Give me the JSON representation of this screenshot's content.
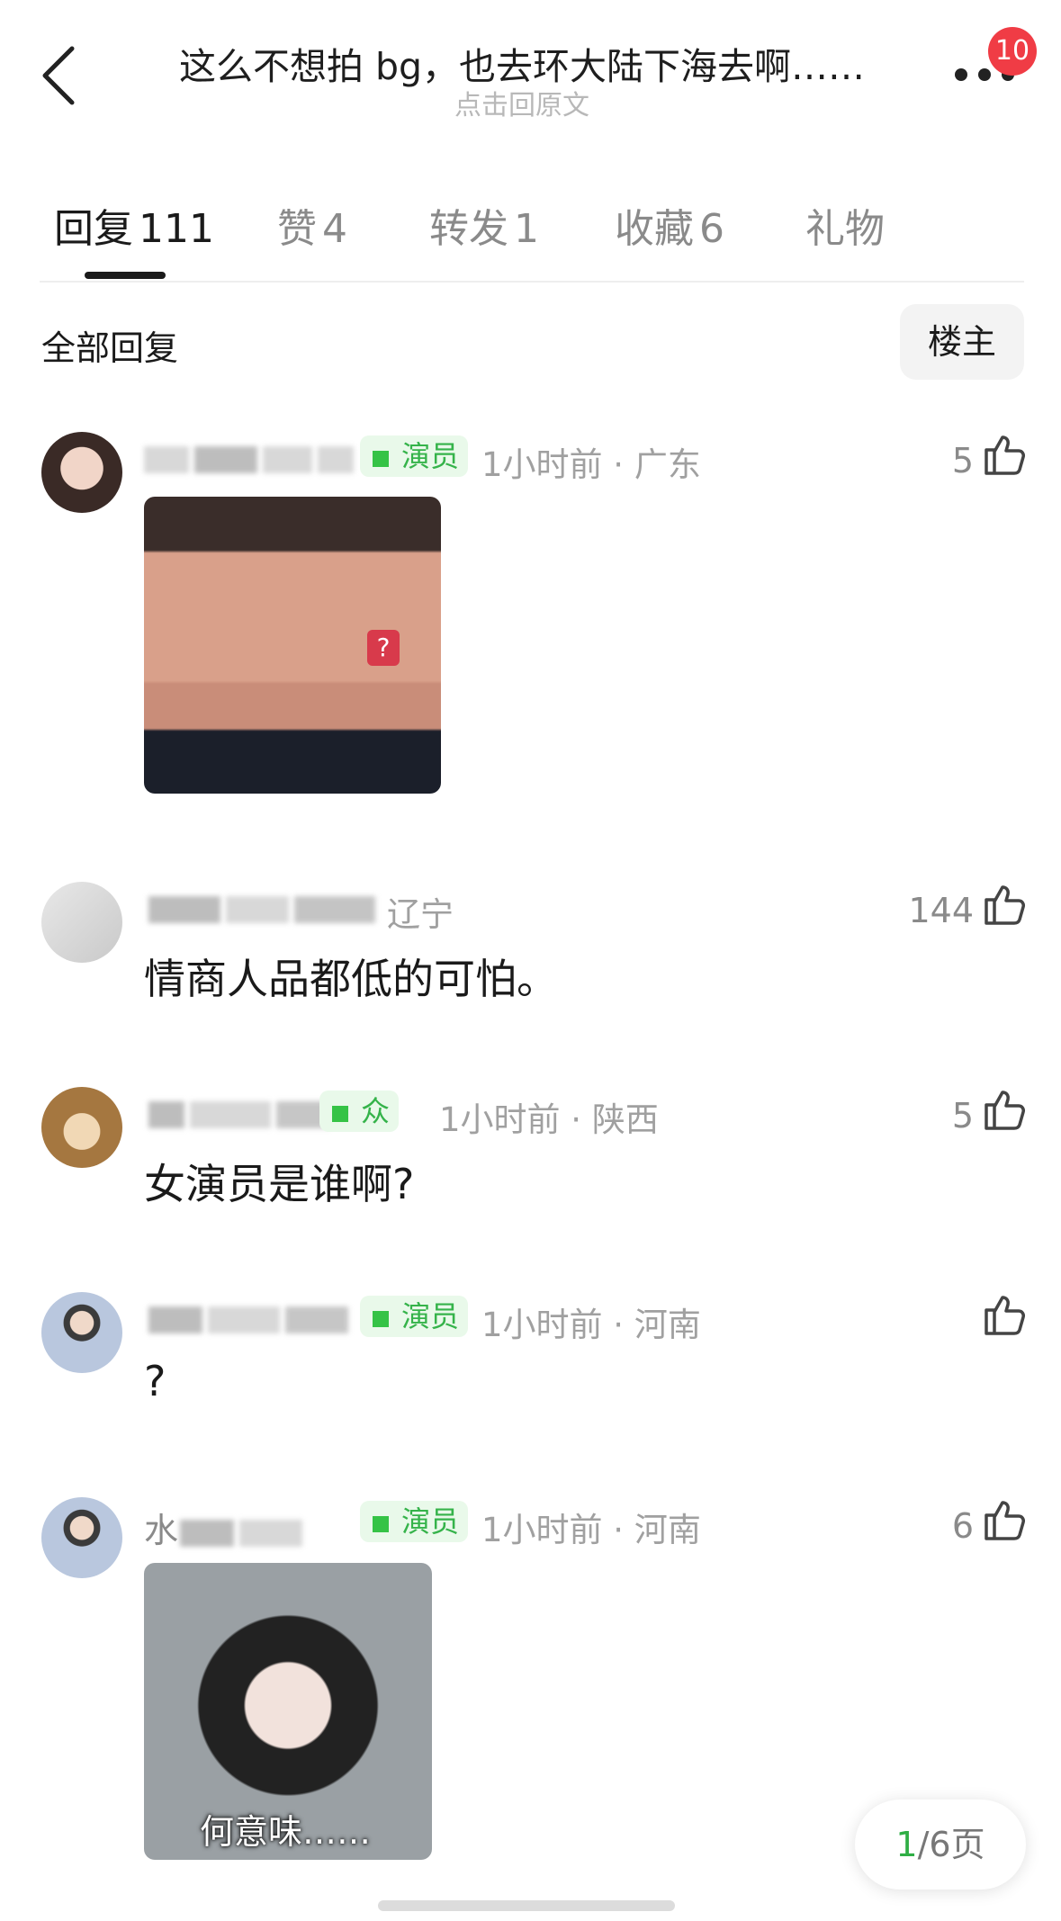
{
  "header": {
    "title": "这么不想拍 bg，也去环大陆下海去啊……",
    "subtitle": "点击回原文",
    "notification_count": "10"
  },
  "tabs": [
    {
      "label": "回复",
      "count": "111"
    },
    {
      "label": "赞",
      "count": "4"
    },
    {
      "label": "转发",
      "count": "1"
    },
    {
      "label": "收藏",
      "count": "6"
    },
    {
      "label": "礼物",
      "count": ""
    }
  ],
  "filter": {
    "all_replies": "全部回复",
    "op_only": "楼主"
  },
  "comments": [
    {
      "badge": "演员",
      "meta": "1小时前 · 广东",
      "likes": "5",
      "text": ""
    },
    {
      "badge": "",
      "meta": "辽宁",
      "likes": "144",
      "text": "情商人品都低的可怕。"
    },
    {
      "badge": "众",
      "meta": "1小时前 · 陕西",
      "likes": "5",
      "text": "女演员是谁啊?"
    },
    {
      "badge": "演员",
      "meta": "1小时前 · 河南",
      "likes": "",
      "text": "?"
    },
    {
      "badge": "演员",
      "meta": "1小时前 · 河南",
      "likes": "6",
      "text": "",
      "sticker_caption": "何意味……",
      "name_prefix": "水"
    }
  ],
  "pager": {
    "current": "1",
    "total": "/6页"
  },
  "colors": {
    "accent_green": "#35b34a",
    "badge_red": "#f03c45"
  },
  "icons": [
    "back-arrow-icon",
    "more-dots-icon",
    "thumbs-up-icon"
  ]
}
